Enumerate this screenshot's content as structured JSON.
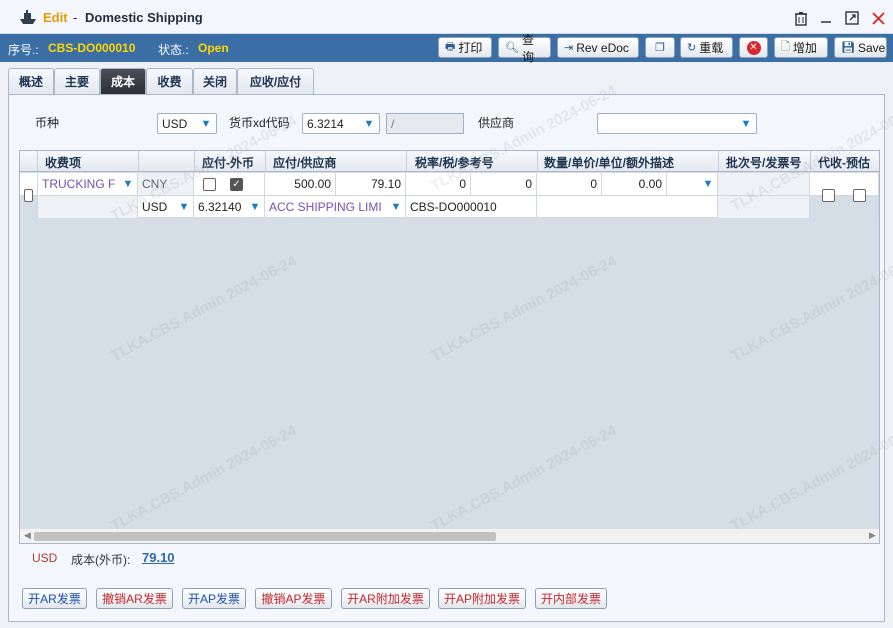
{
  "window": {
    "mode": "Edit",
    "separator": "-",
    "title": "Domestic Shipping"
  },
  "infobar": {
    "seq_label": "序号.:",
    "seq_value": "CBS-DO000010",
    "status_label": "状态.:",
    "status_value": "Open"
  },
  "toolbar": {
    "print": "打印",
    "query": "查询",
    "rev_edoc": "Rev eDoc",
    "reload": "重载",
    "add": "增加",
    "save": "Save"
  },
  "tabs": [
    "概述",
    "主要",
    "成本",
    "收费",
    "关闭",
    "应收/应付"
  ],
  "form": {
    "currency_label": "币种",
    "currency_value": "USD",
    "rate_label": "货币xd代码",
    "rate_value": "6.3214",
    "rate_disabled": "/",
    "supplier_label": "供应商",
    "supplier_value": ""
  },
  "grid": {
    "headers": [
      "收费项",
      "应付-外币",
      "应付/供应商",
      "税率/税/参考号",
      "数量/单价/单位/额外描述",
      "批次号/发票号",
      "代收-预估"
    ],
    "row": {
      "charge_item": "TRUCKING F",
      "currency_local": "CNY",
      "amount_local": "500.00",
      "amount_foreign": "79.10",
      "tax_rate": "0",
      "tax": "0",
      "qty": "0",
      "unit_price": "0.00",
      "currency": "USD",
      "ex_rate": "6.32140",
      "supplier": "ACC SHIPPING LIMI",
      "ref_no": "CBS-DO000010"
    }
  },
  "summary": {
    "currency": "USD",
    "label": "成本(外币):",
    "amount": "79.10"
  },
  "bottom_buttons": {
    "open_ar_invoice": "开AR发票",
    "cancel_ar_invoice": "撤销AR发票",
    "open_ap_invoice": "开AP发票",
    "cancel_ap_invoice": "撤销AP发票",
    "open_ar_extra": "开AR附加发票",
    "open_ap_extra": "开AP附加发票",
    "open_internal": "开内部发票"
  },
  "watermark": "TLKA.CBS.Admin 2024-06-24",
  "colors": {
    "accent_blue": "#3a6ea5",
    "status_yellow": "#ffd700",
    "title_edit": "#e69a00",
    "link_blue": "#2b6aa5"
  }
}
